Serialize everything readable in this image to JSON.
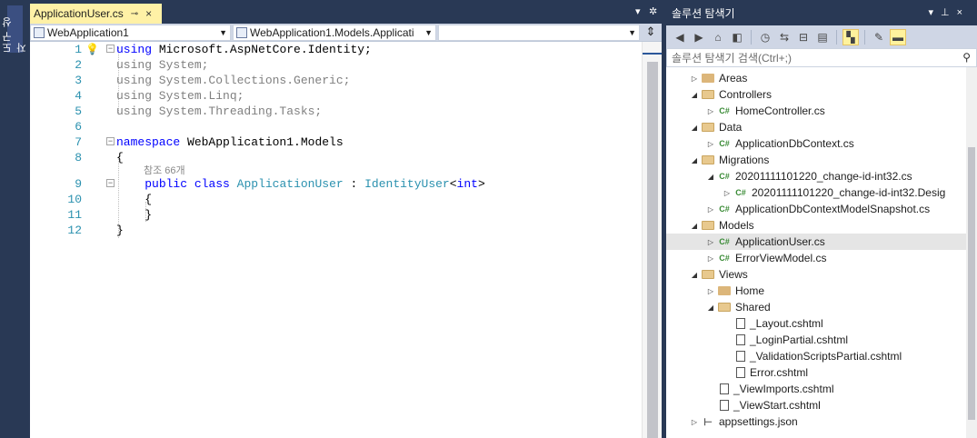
{
  "toolstrip": {
    "vertical_tab": "도구 상자"
  },
  "editor": {
    "tab": {
      "title": "ApplicationUser.cs",
      "pin": "⊸",
      "close": "×"
    },
    "tab_controls": {
      "dropdown": "▾",
      "settings": "✲"
    },
    "nav": {
      "project": "WebApplication1",
      "class": "WebApplication1.Models.Applicati",
      "member": ""
    },
    "lines": [
      {
        "num": "1"
      },
      {
        "num": "2"
      },
      {
        "num": "3"
      },
      {
        "num": "4"
      },
      {
        "num": "5"
      },
      {
        "num": "6"
      },
      {
        "num": "7"
      },
      {
        "num": "8"
      },
      {
        "num": "9"
      },
      {
        "num": "10"
      },
      {
        "num": "11"
      },
      {
        "num": "12"
      }
    ],
    "code": {
      "l1_kw": "using",
      "l1_rest": " Microsoft.AspNetCore.Identity;",
      "l2": "using System;",
      "l3": "using System.Collections.Generic;",
      "l4": "using System.Linq;",
      "l5": "using System.Threading.Tasks;",
      "l7_kw": "namespace",
      "l7_rest": " WebApplication1.Models",
      "l8": "{",
      "ref_count": "참조 66개",
      "l9_kw1": "public",
      "l9_kw2": "class",
      "l9_type": "ApplicationUser",
      "l9_colon": " : ",
      "l9_base": "IdentityUser",
      "l9_lt": "<",
      "l9_int": "int",
      "l9_gt": ">",
      "l10": "{",
      "l11": "}",
      "l12": "}"
    }
  },
  "solution_explorer": {
    "title": "솔루션 탐색기",
    "search_placeholder": "솔루션 탐색기 검색(Ctrl+;)",
    "tree": [
      {
        "label": "Areas",
        "kind": "folder",
        "expander": "▷",
        "indent": 0
      },
      {
        "label": "Controllers",
        "kind": "folder-open",
        "expander": "◢",
        "indent": 0
      },
      {
        "label": "HomeController.cs",
        "kind": "cs",
        "expander": "▷",
        "indent": 1
      },
      {
        "label": "Data",
        "kind": "folder-open",
        "expander": "◢",
        "indent": 0
      },
      {
        "label": "ApplicationDbContext.cs",
        "kind": "cs",
        "expander": "▷",
        "indent": 1
      },
      {
        "label": "Migrations",
        "kind": "folder-open",
        "expander": "◢",
        "indent": 0
      },
      {
        "label": "20201111101220_change-id-int32.cs",
        "kind": "cs",
        "expander": "◢",
        "indent": 1
      },
      {
        "label": "20201111101220_change-id-int32.Desig",
        "kind": "cs",
        "expander": "▷",
        "indent": 2
      },
      {
        "label": "ApplicationDbContextModelSnapshot.cs",
        "kind": "cs",
        "expander": "▷",
        "indent": 1
      },
      {
        "label": "Models",
        "kind": "folder-open",
        "expander": "◢",
        "indent": 0
      },
      {
        "label": "ApplicationUser.cs",
        "kind": "cs",
        "expander": "▷",
        "indent": 1,
        "selected": true
      },
      {
        "label": "ErrorViewModel.cs",
        "kind": "cs",
        "expander": "▷",
        "indent": 1
      },
      {
        "label": "Views",
        "kind": "folder-open",
        "expander": "◢",
        "indent": 0
      },
      {
        "label": "Home",
        "kind": "folder",
        "expander": "▷",
        "indent": 1
      },
      {
        "label": "Shared",
        "kind": "folder-open",
        "expander": "◢",
        "indent": 1
      },
      {
        "label": "_Layout.cshtml",
        "kind": "file",
        "expander": "",
        "indent": 2
      },
      {
        "label": "_LoginPartial.cshtml",
        "kind": "file",
        "expander": "",
        "indent": 2
      },
      {
        "label": "_ValidationScriptsPartial.cshtml",
        "kind": "file",
        "expander": "",
        "indent": 2
      },
      {
        "label": "Error.cshtml",
        "kind": "file",
        "expander": "",
        "indent": 2
      },
      {
        "label": "_ViewImports.cshtml",
        "kind": "file",
        "expander": "",
        "indent": 1
      },
      {
        "label": "_ViewStart.cshtml",
        "kind": "file",
        "expander": "",
        "indent": 1
      },
      {
        "label": "appsettings.json",
        "kind": "json",
        "expander": "▷",
        "indent": 0
      }
    ]
  },
  "colors": {
    "chrome": "#293955",
    "active_tab": "#fff1a6",
    "keyword": "#0000ff",
    "type": "#2b91af"
  }
}
